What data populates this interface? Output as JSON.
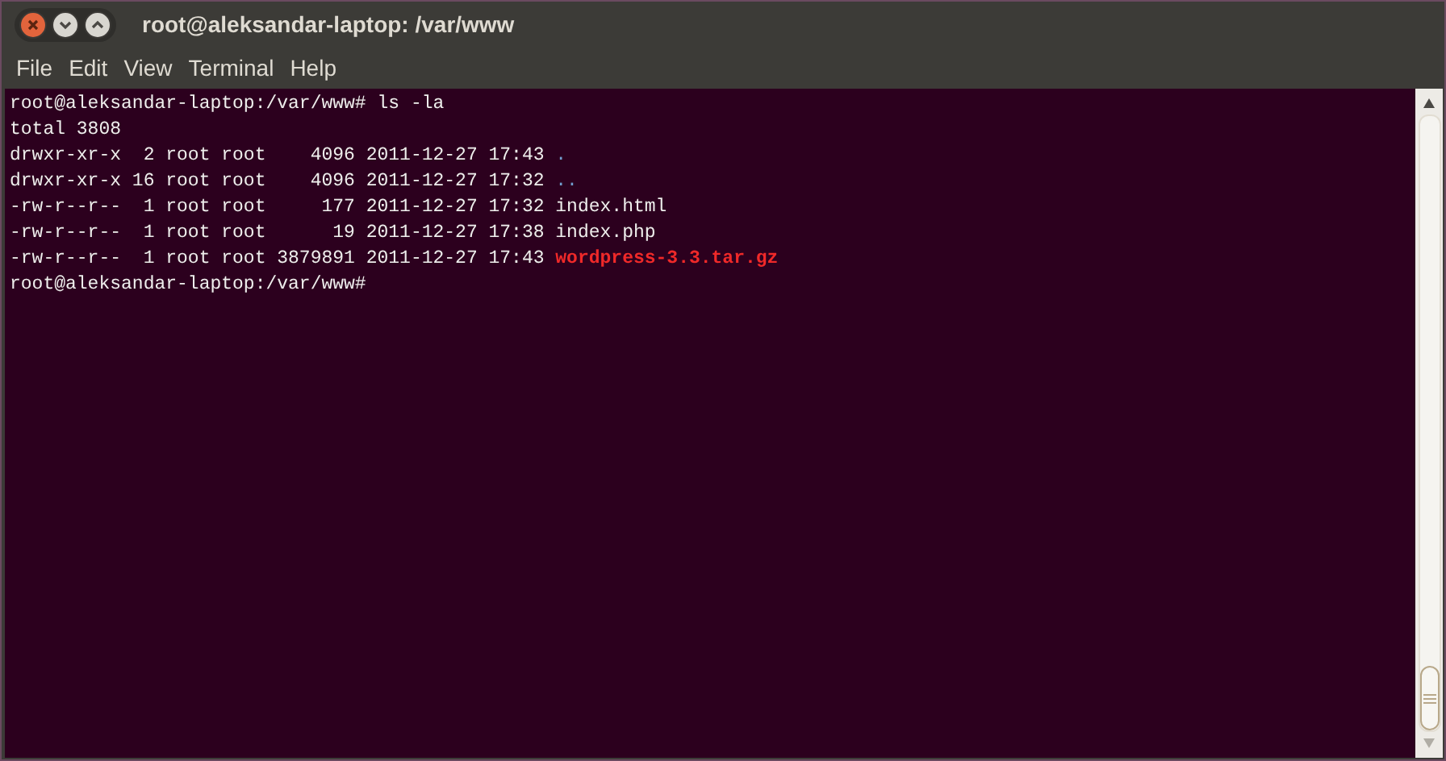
{
  "window": {
    "title": "root@aleksandar-laptop: /var/www"
  },
  "menu": [
    "File",
    "Edit",
    "View",
    "Terminal",
    "Help"
  ],
  "terminal": {
    "lines": [
      {
        "kind": "plain",
        "text": "root@aleksandar-laptop:/var/www# ls -la"
      },
      {
        "kind": "plain",
        "text": "total 3808"
      },
      {
        "kind": "entry",
        "meta": "drwxr-xr-x  2 root root    4096 2011-12-27 17:43",
        "name": ".",
        "color": "#729fcf",
        "bold": false
      },
      {
        "kind": "entry",
        "meta": "drwxr-xr-x 16 root root    4096 2011-12-27 17:32",
        "name": "..",
        "color": "#729fcf",
        "bold": false
      },
      {
        "kind": "entry",
        "meta": "-rw-r--r--  1 root root     177 2011-12-27 17:32",
        "name": "index.html",
        "color": "#eeeeec",
        "bold": false
      },
      {
        "kind": "entry",
        "meta": "-rw-r--r--  1 root root      19 2011-12-27 17:38",
        "name": "index.php",
        "color": "#eeeeec",
        "bold": false
      },
      {
        "kind": "entry",
        "meta": "-rw-r--r--  1 root root 3879891 2011-12-27 17:43",
        "name": "wordpress-3.3.tar.gz",
        "color": "#ef2929",
        "bold": true
      },
      {
        "kind": "plain",
        "text": "root@aleksandar-laptop:/var/www#"
      }
    ]
  }
}
